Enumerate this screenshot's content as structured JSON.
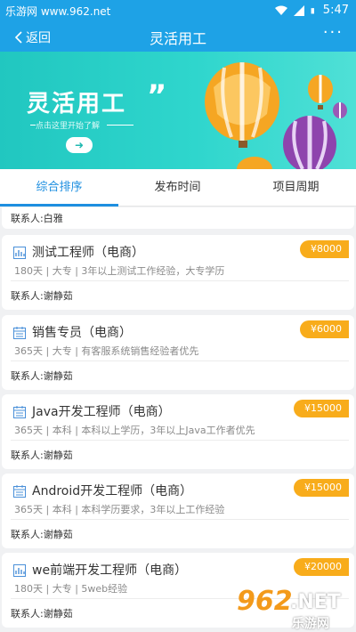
{
  "status_bar": {
    "site_label": "乐游网 www.962.net",
    "time": "5:47"
  },
  "nav": {
    "back_label": "返回",
    "title": "灵活用工",
    "more_label": "···"
  },
  "banner": {
    "title": "灵活用工",
    "quote": "”",
    "subtitle": "点击这里开始了解",
    "arrow": "➜"
  },
  "tabs": [
    {
      "label": "综合排序",
      "active": true
    },
    {
      "label": "发布时间",
      "active": false
    },
    {
      "label": "项目周期",
      "active": false
    }
  ],
  "partial_item": {
    "contact": "联系人:白雅"
  },
  "jobs": [
    {
      "icon": "chart-icon",
      "title": "测试工程师（电商）",
      "meta": "180天 | 大专 | 3年以上测试工作经验，大专学历",
      "contact": "联系人:谢静茹",
      "salary": "¥8000"
    },
    {
      "icon": "calendar-icon",
      "title": "销售专员（电商）",
      "meta": "365天 | 大专 | 有客服系统销售经验者优先",
      "contact": "联系人:谢静茹",
      "salary": "¥6000"
    },
    {
      "icon": "calendar-icon",
      "title": "Java开发工程师（电商）",
      "meta": "365天 | 本科 | 本科以上学历，3年以上Java工作者优先",
      "contact": "联系人:谢静茹",
      "salary": "¥15000"
    },
    {
      "icon": "calendar-icon",
      "title": "Android开发工程师（电商）",
      "meta": "365天 | 本科 | 本科学历要求，3年以上工作经验",
      "contact": "联系人:谢静茹",
      "salary": "¥15000"
    },
    {
      "icon": "chart-icon",
      "title": "we前端开发工程师（电商）",
      "meta": "180天 | 大专 | 5web经验",
      "contact": "联系人:谢静茹",
      "salary": "¥20000"
    }
  ],
  "watermark": {
    "num": "962",
    "net": ".NET",
    "cn": "乐游网"
  },
  "colors": {
    "primary": "#1ea2e6",
    "tab_active": "#1e8fe0",
    "salary_badge": "#f8ac1b",
    "banner": "#21c7c0"
  }
}
